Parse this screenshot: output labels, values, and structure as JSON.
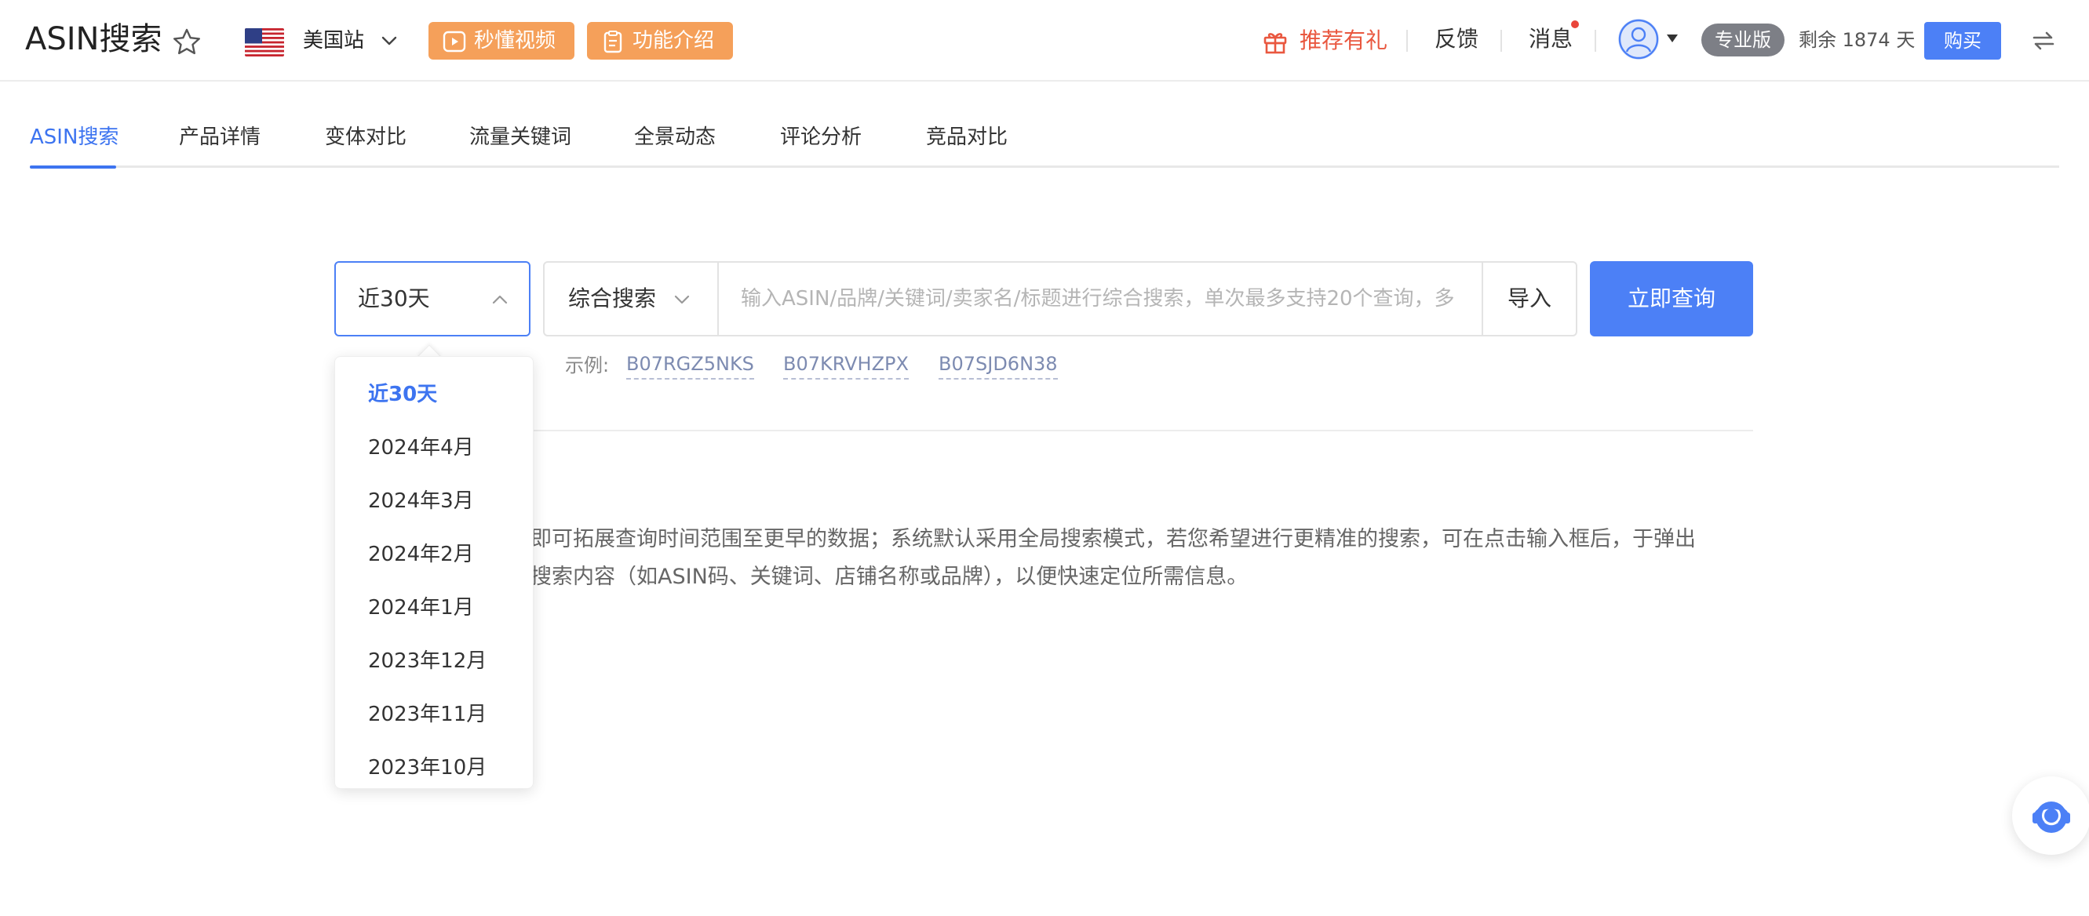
{
  "header": {
    "app_title": "ASIN搜索",
    "site": "美国站",
    "btn_video": "秒懂视频",
    "btn_intro": "功能介绍",
    "recommend": "推荐有礼",
    "feedback": "反馈",
    "messages": "消息",
    "plan_badge": "专业版",
    "remaining": "剩余 1874 天",
    "buy": "购买",
    "colors": {
      "accent": "#4c80f6",
      "orange": "#f5a05a",
      "recommend": "#e9573f"
    }
  },
  "tabs": [
    {
      "label": "ASIN搜索",
      "active": true
    },
    {
      "label": "产品详情"
    },
    {
      "label": "变体对比"
    },
    {
      "label": "流量关键词"
    },
    {
      "label": "全景动态"
    },
    {
      "label": "评论分析"
    },
    {
      "label": "竞品对比"
    }
  ],
  "search": {
    "period_value": "近30天",
    "mode_value": "综合搜索",
    "placeholder": "输入ASIN/品牌/关键词/卖家名/标题进行综合搜索，单次最多支持20个查询，多",
    "import": "导入",
    "submit": "立即查询",
    "examples_label": "示例:",
    "examples": [
      "B07RGZ5NKS",
      "B07KRVHZPX",
      "B07SJD6N38"
    ]
  },
  "description": {
    "line1": "即可拓展查询时间范围至更早的数据；系统默认采用全局搜索模式，若您希望进行更精准的搜索，可在点击输入框后，于弹出",
    "line2": "搜索内容（如ASIN码、关键词、店铺名称或品牌），以便快速定位所需信息。"
  },
  "period_dropdown": {
    "options": [
      "近30天",
      "2024年4月",
      "2024年3月",
      "2024年2月",
      "2024年1月",
      "2023年12月",
      "2023年11月",
      "2023年10月"
    ],
    "selected": "近30天"
  }
}
